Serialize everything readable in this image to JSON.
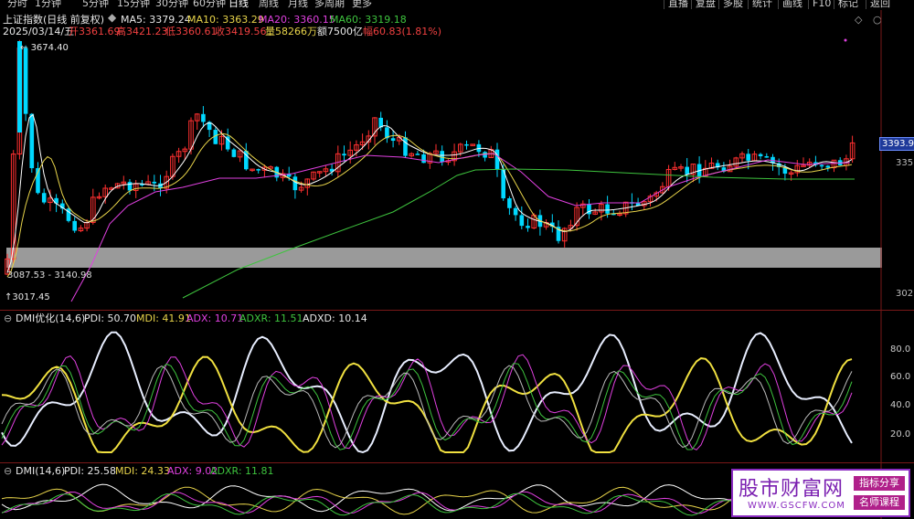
{
  "toolbar": {
    "periods": [
      "分时",
      "1分钟",
      "5分钟",
      "15分钟",
      "30分钟",
      "60分钟",
      "日线",
      "周线",
      "月线",
      "多周期",
      "更多"
    ],
    "active_period": "日线",
    "buttons": [
      "直播",
      "复盘",
      "多股",
      "统计",
      "画线",
      "F10",
      "标记",
      "返回"
    ]
  },
  "header": {
    "title": "上证指数(日线 前复权)",
    "ma5": "MA5: 3379.24",
    "ma10": "MA10: 3363.29",
    "ma20": "MA20: 3360.15",
    "ma60": "MA60: 3319.18",
    "date": "2025/03/14/五",
    "open": "开3361.69",
    "high": "高3421.23",
    "low": "低3360.61",
    "close": "收3419.56",
    "volume": "量58266万",
    "amount": "额7500亿",
    "amplitude": "幅60.83(1.81%)"
  },
  "main_chart": {
    "high_label": "3674.40",
    "low_label": "3017.45",
    "range_label": "3087.53 - 3140.98",
    "price_box": "3393.9",
    "y_ticks": [
      "335",
      "302"
    ],
    "colors": {
      "up": "#ff3030",
      "down": "#00d8ff",
      "ma5": "#ffffff",
      "ma10": "#e8d44a",
      "ma20": "#e040e0",
      "ma60": "#3ec43e"
    }
  },
  "dmi_opt": {
    "name": "DMI优化(14,6)",
    "pdi": "PDI: 50.70",
    "mdi": "MDI: 41.91",
    "adx": "ADX: 10.71",
    "adxr": "ADXR: 11.51",
    "adxd": "ADXD: 10.14",
    "y_ticks": [
      "80.0",
      "60.0",
      "40.0",
      "20.0"
    ]
  },
  "dmi": {
    "name": "DMI(14,6)",
    "pdi": "PDI: 25.58",
    "mdi": "MDI: 24.33",
    "adx": "ADX: 9.02",
    "adxr": "ADXR: 11.81"
  },
  "watermark": {
    "name": "股市财富网",
    "url": "WWW.GSCFW.COM",
    "tag1": "指标分享",
    "tag2": "名师课程"
  }
}
